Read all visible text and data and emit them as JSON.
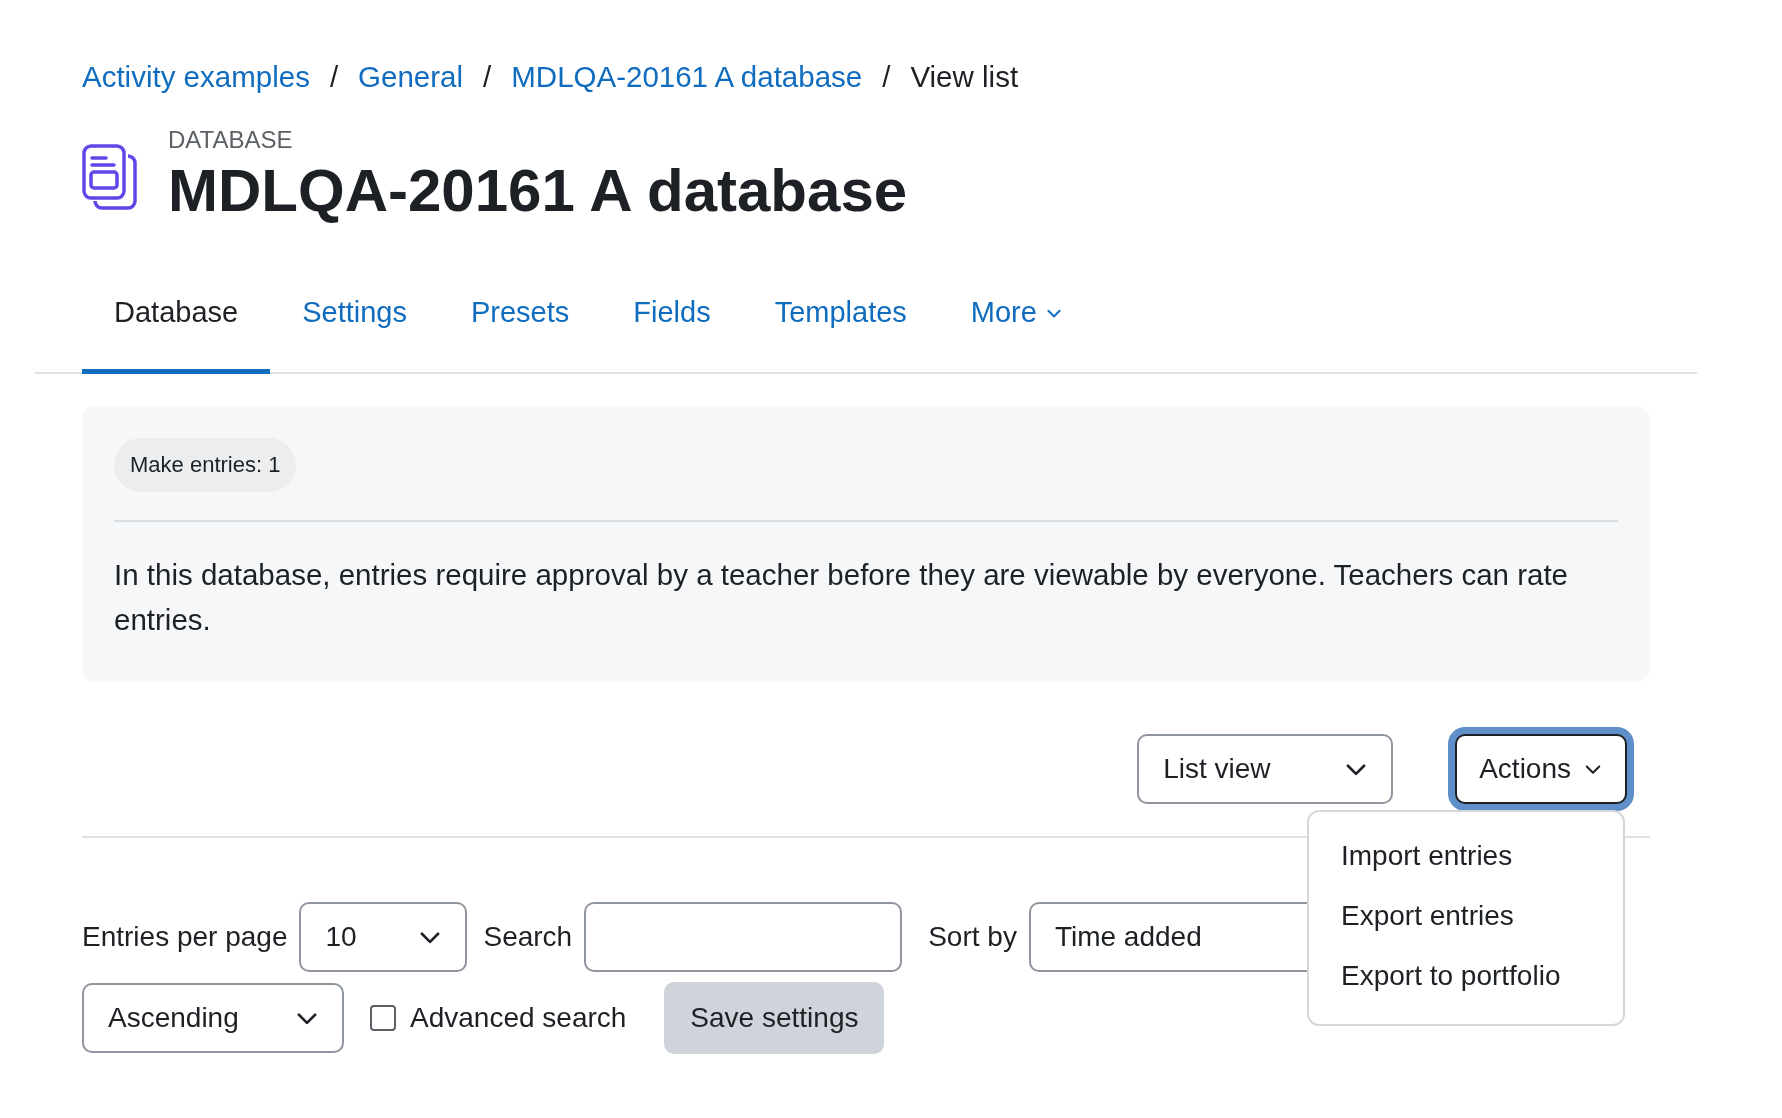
{
  "breadcrumb": {
    "separator": "/",
    "items": [
      {
        "label": "Activity examples",
        "current": false
      },
      {
        "label": "General",
        "current": false
      },
      {
        "label": "MDLQA-20161 A database",
        "current": false
      },
      {
        "label": "View list",
        "current": true
      }
    ]
  },
  "header": {
    "module_type": "DATABASE",
    "title": "MDLQA-20161 A database"
  },
  "tabs": [
    {
      "label": "Database",
      "selected": true,
      "kind": "tab"
    },
    {
      "label": "Settings",
      "selected": false,
      "kind": "tab"
    },
    {
      "label": "Presets",
      "selected": false,
      "kind": "tab"
    },
    {
      "label": "Fields",
      "selected": false,
      "kind": "tab"
    },
    {
      "label": "Templates",
      "selected": false,
      "kind": "tab"
    },
    {
      "label": "More",
      "selected": false,
      "kind": "dropdown"
    }
  ],
  "info": {
    "badge": "Make entries: 1",
    "description": "In this database, entries require approval by a teacher before they are viewable by everyone. Teachers can rate entries."
  },
  "view_select": {
    "value": "List view"
  },
  "actions_button": {
    "label": "Actions",
    "expanded": true
  },
  "actions_menu": {
    "items": [
      "Import entries",
      "Export entries",
      "Export to portfolio"
    ]
  },
  "filters": {
    "entries_per_page": {
      "label": "Entries per page",
      "value": "10"
    },
    "search": {
      "label": "Search"
    },
    "sort_by": {
      "label": "Sort by",
      "value": "Time added"
    },
    "order": {
      "value": "Ascending"
    },
    "advanced_search": {
      "label": "Advanced search",
      "checked": false
    },
    "save_button": "Save settings"
  }
}
